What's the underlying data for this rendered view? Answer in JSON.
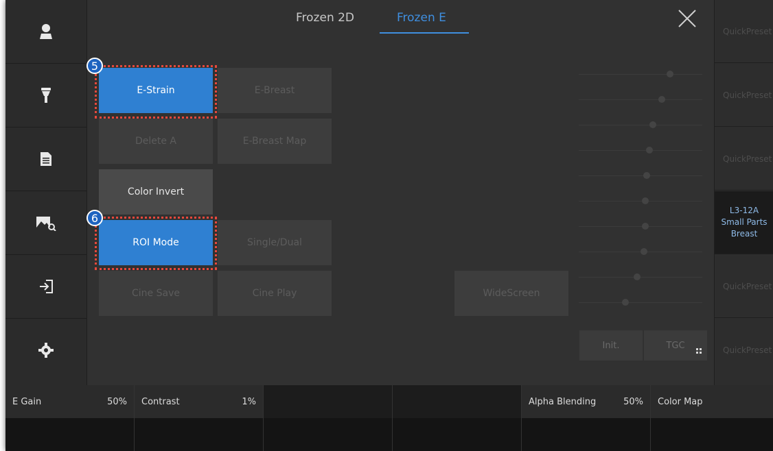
{
  "tabs": [
    {
      "label": "Frozen 2D",
      "active": false
    },
    {
      "label": "Frozen E",
      "active": true
    }
  ],
  "sidebar": {
    "icons": [
      "patient-icon",
      "probe-icon",
      "report-icon",
      "image-review-icon",
      "exit-icon",
      "settings-icon"
    ]
  },
  "buttons": {
    "e_strain": "E-Strain",
    "e_breast": "E-Breast",
    "delete_a": "Delete A",
    "e_breast_map": "E-Breast Map",
    "color_invert": "Color Invert",
    "roi_mode": "ROI Mode",
    "single_dual": "Single/Dual",
    "cine_save": "Cine Save",
    "cine_play": "Cine Play",
    "widescreen": "WideScreen"
  },
  "callouts": {
    "e_strain": "5",
    "roi_mode": "6"
  },
  "tgc": {
    "init_label": "Init.",
    "tgc_label": "TGC",
    "levels": [
      0.74,
      0.67,
      0.6,
      0.57,
      0.55,
      0.54,
      0.54,
      0.53,
      0.47,
      0.38
    ]
  },
  "presets": [
    {
      "label": "QuickPreset",
      "selected": false
    },
    {
      "label": "QuickPreset",
      "selected": false
    },
    {
      "label": "QuickPreset",
      "selected": false
    },
    {
      "label": "L3-12A\nSmall Parts\nBreast",
      "selected": true
    },
    {
      "label": "QuickPreset",
      "selected": false
    },
    {
      "label": "QuickPreset",
      "selected": false
    }
  ],
  "params": [
    {
      "label": "E Gain",
      "value": "50%",
      "enabled": true
    },
    {
      "label": "Contrast",
      "value": "1%",
      "enabled": true
    },
    {
      "label": "",
      "value": "",
      "enabled": false
    },
    {
      "label": "",
      "value": "",
      "enabled": false
    },
    {
      "label": "Alpha Blending",
      "value": "50%",
      "enabled": true
    },
    {
      "label": "Color Map",
      "value": "",
      "enabled": true
    }
  ],
  "colors": {
    "accent": "#2f80d2",
    "highlight": "#e8483c",
    "tab_active": "#3f8fe0"
  }
}
